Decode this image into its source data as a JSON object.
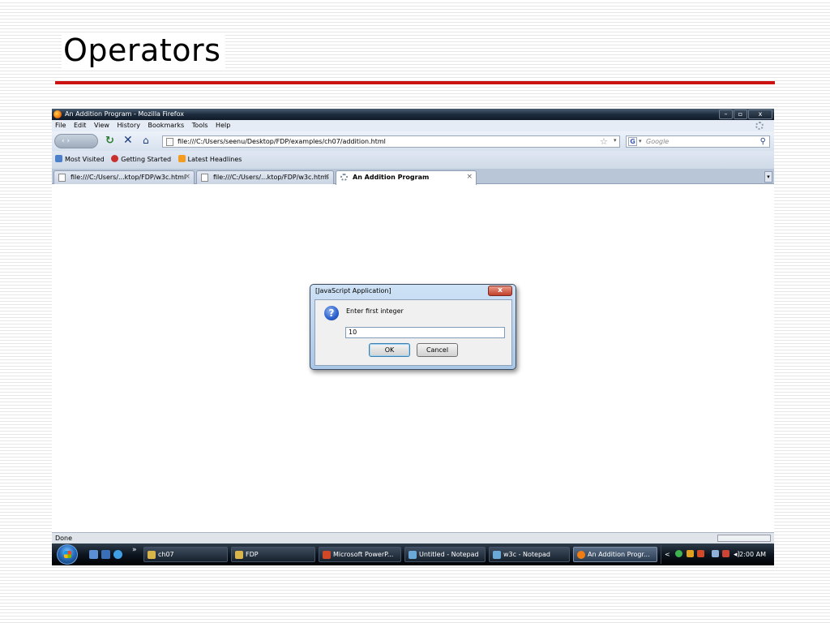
{
  "slide": {
    "title": "Operators"
  },
  "window": {
    "title": "An Addition Program - Mozilla Firefox",
    "minimize": "–",
    "maximize": "▫",
    "close": "x"
  },
  "menu": {
    "items": [
      "File",
      "Edit",
      "View",
      "History",
      "Bookmarks",
      "Tools",
      "Help"
    ]
  },
  "navigation": {
    "back_label": "‹ ›",
    "url": "file:///C:/Users/seenu/Desktop/FDP/examples/ch07/addition.html",
    "search_placeholder": "Google",
    "search_engine_icon": "G"
  },
  "bookmarks": {
    "items": [
      "Most Visited",
      "Getting Started",
      "Latest Headlines"
    ]
  },
  "tabs": [
    {
      "label": "file:///C:/Users/...ktop/FDP/w3c.html",
      "active": false
    },
    {
      "label": "file:///C:/Users/...ktop/FDP/w3c.html",
      "active": false
    },
    {
      "label": "An Addition Program",
      "active": true
    }
  ],
  "status": {
    "text": "Done"
  },
  "dialog": {
    "title": "[JavaScript Application]",
    "message": "Enter first integer",
    "input_value": "10",
    "ok_label": "OK",
    "cancel_label": "Cancel"
  },
  "taskbar": {
    "overflow": "»",
    "buttons": [
      {
        "label": "ch07",
        "color": "#d9b64a"
      },
      {
        "label": "FDP",
        "color": "#d9b64a"
      },
      {
        "label": "Microsoft PowerP...",
        "color": "#d24726"
      },
      {
        "label": "Untitled - Notepad",
        "color": "#6aa8d8"
      },
      {
        "label": "w3c - Notepad",
        "color": "#6aa8d8"
      },
      {
        "label": "An Addition Progr...",
        "color": "#f07d12",
        "active": true
      }
    ],
    "tray_chevron": "<",
    "clock": "2:00 AM"
  },
  "colors": {
    "title_rule": "#cc1111",
    "titlebar_dark": "#101a28",
    "taskbar_dark": "#0d1620"
  }
}
